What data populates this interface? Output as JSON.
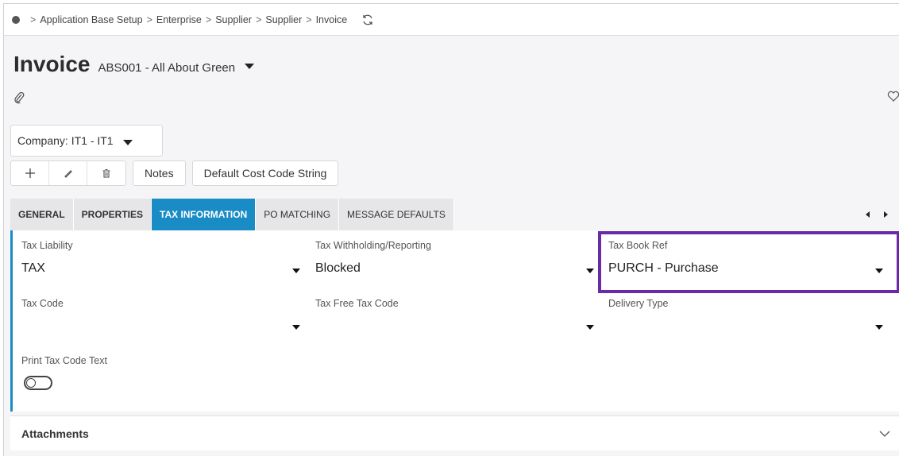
{
  "breadcrumb": {
    "items": [
      "Application Base Setup",
      "Enterprise",
      "Supplier",
      "Supplier",
      "Invoice"
    ]
  },
  "header": {
    "title": "Invoice",
    "subtitle": "ABS001 - All About Green"
  },
  "company_selector": {
    "label": "Company: IT1 - IT1"
  },
  "toolbar": {
    "notes_label": "Notes",
    "default_cost_code_label": "Default Cost Code String"
  },
  "tabs": [
    {
      "label": "GENERAL",
      "active": false
    },
    {
      "label": "PROPERTIES",
      "active": false
    },
    {
      "label": "TAX INFORMATION",
      "active": true
    },
    {
      "label": "PO MATCHING",
      "active": false
    },
    {
      "label": "MESSAGE DEFAULTS",
      "active": false
    }
  ],
  "fields": {
    "tax_liability": {
      "label": "Tax Liability",
      "value": "TAX"
    },
    "tax_withholding": {
      "label": "Tax Withholding/Reporting",
      "value": "Blocked"
    },
    "tax_book_ref": {
      "label": "Tax Book Ref",
      "value": "PURCH - Purchase"
    },
    "tax_code": {
      "label": "Tax Code",
      "value": ""
    },
    "tax_free_tax_code": {
      "label": "Tax Free Tax Code",
      "value": ""
    },
    "delivery_type": {
      "label": "Delivery Type",
      "value": ""
    },
    "print_tax_code_text": {
      "label": "Print Tax Code Text",
      "enabled": false
    }
  },
  "attachments": {
    "label": "Attachments"
  },
  "colors": {
    "accent": "#1a8cc5",
    "highlight": "#6a2aa6"
  },
  "icons": [
    "refresh-icon",
    "paperclip-icon",
    "heart-icon",
    "plus-icon",
    "pencil-icon",
    "trash-icon",
    "chevron-down-icon"
  ]
}
